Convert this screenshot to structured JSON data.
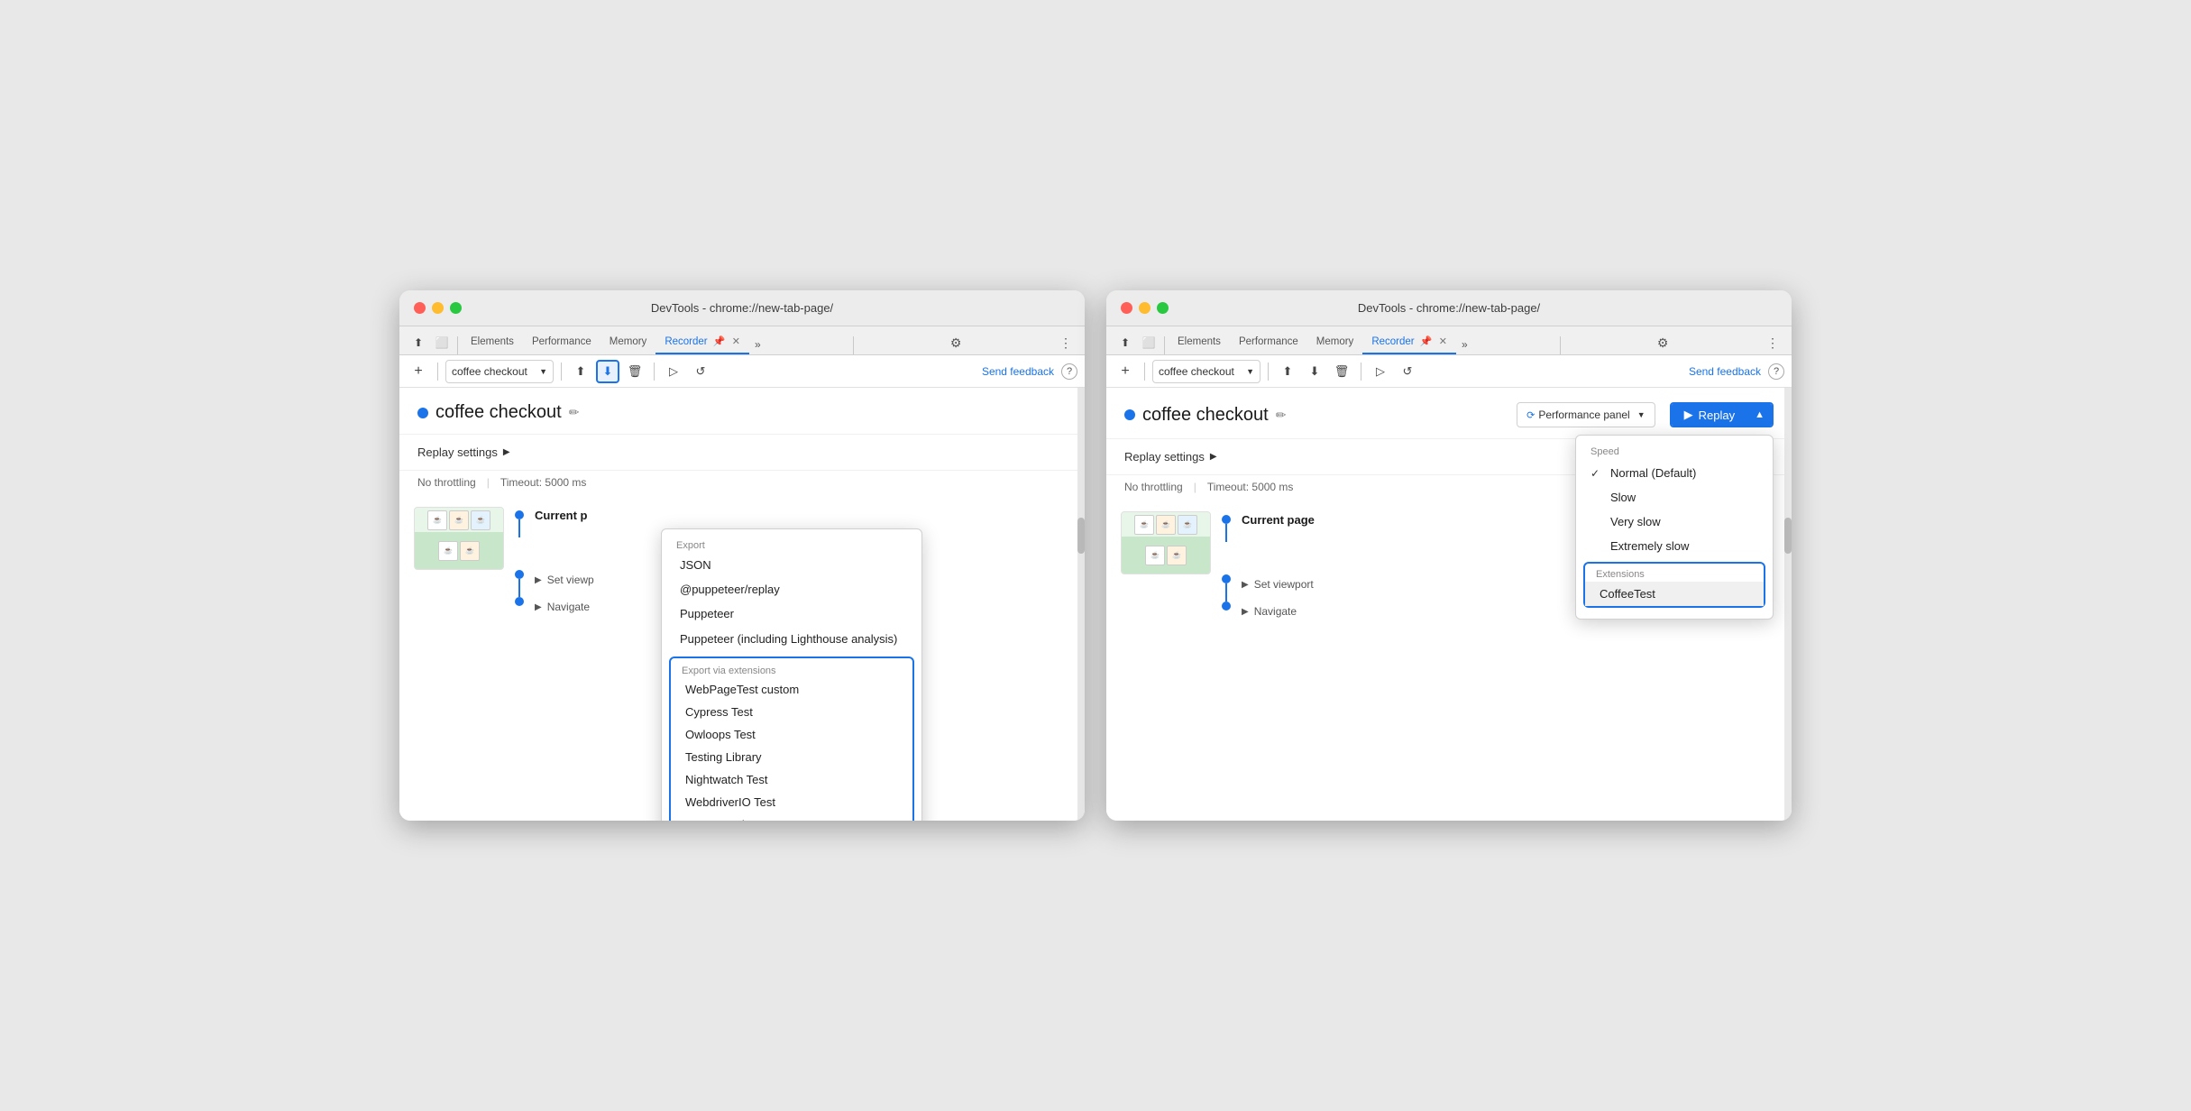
{
  "colors": {
    "blue": "#1a73e8",
    "red": "#ff5f57",
    "yellow": "#febc2e",
    "green": "#28c840"
  },
  "window_left": {
    "title": "DevTools - chrome://new-tab-page/",
    "tabs": [
      "Elements",
      "Performance",
      "Memory",
      "Recorder",
      ""
    ],
    "active_tab": "Recorder",
    "recording_name_toolbar": "coffee checkout",
    "recording_name_header": "coffee checkout",
    "send_feedback": "Send feedback",
    "replay_settings_label": "Replay settings",
    "no_throttling": "No throttling",
    "timeout": "Timeout: 5000 ms",
    "current_page": "Current p",
    "set_viewport": "Set viewp",
    "navigate": "Navigate",
    "export_label": "Export",
    "export_json": "JSON",
    "export_puppeteer_replay": "@puppeteer/replay",
    "export_puppeteer": "Puppeteer",
    "export_puppeteer_lighthouse": "Puppeteer (including Lighthouse\nanalysis)",
    "export_via_extensions": "Export via extensions",
    "ext_webpagetest": "WebPageTest custom",
    "ext_cypress": "Cypress Test",
    "ext_owloops": "Owloops Test",
    "ext_testing_library": "Testing Library",
    "ext_nightwatch": "Nightwatch Test",
    "ext_webdriverio": "WebdriverIO Test",
    "ext_get_extensions": "Get extensions..."
  },
  "window_right": {
    "title": "DevTools - chrome://new-tab-page/",
    "tabs": [
      "Elements",
      "Performance",
      "Memory",
      "Recorder",
      ""
    ],
    "active_tab": "Recorder",
    "recording_name_toolbar": "coffee checkout",
    "recording_name_header": "coffee checkout",
    "send_feedback": "Send feedback",
    "replay_settings_label": "Replay settings",
    "no_throttling": "No throttling",
    "timeout": "Timeout: 5000 ms",
    "perf_panel": "Performance panel",
    "replay_btn": "Replay",
    "current_page": "Current page",
    "set_viewport": "Set viewport",
    "navigate": "Navigate",
    "speed_label": "Speed",
    "speed_normal": "Normal (Default)",
    "speed_slow": "Slow",
    "speed_very_slow": "Very slow",
    "speed_extremely_slow": "Extremely slow",
    "extensions_label": "Extensions",
    "ext_coffeetest": "CoffeeTest"
  }
}
